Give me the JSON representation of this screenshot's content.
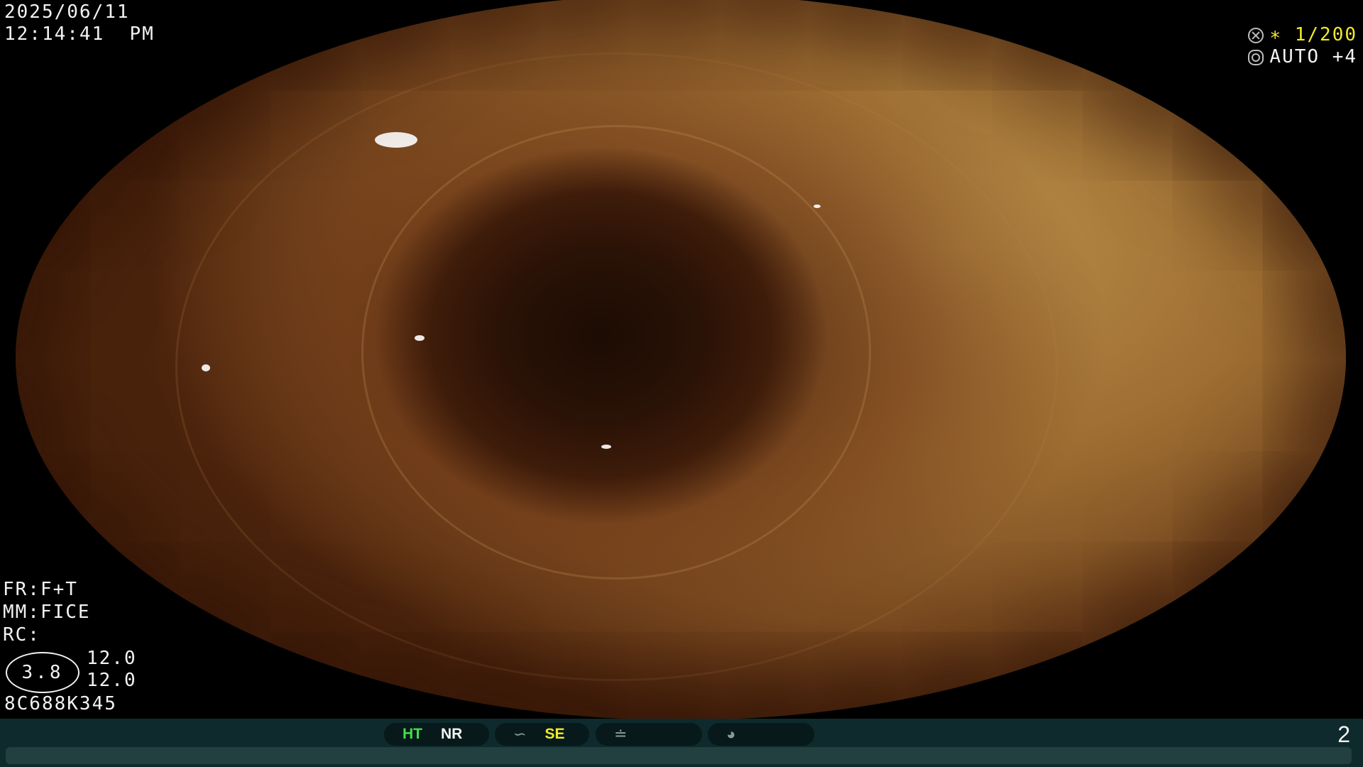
{
  "overlay": {
    "date": "2025/06/11",
    "time": "12:14:41  PM",
    "fr": "FR:F+T",
    "mm": "MM:FICE",
    "rc": "RC:",
    "scope_value": "3.8",
    "value_1": "12.0",
    "value_2": "12.0",
    "serial": "8C688K345"
  },
  "top_right": {
    "shutter": "∗ 1/200",
    "iris": "AUTO +4",
    "shutter_icon": "shutter-icon",
    "iris_icon": "iris-icon",
    "shutter_color": "#f2ea2a"
  },
  "status": {
    "ht": "HT",
    "nr": "NR",
    "se": "SE",
    "se_icon": "wave-icon",
    "slash_icon": "slash-wave-icon",
    "gauge_icon": "gauge-icon",
    "page": "2",
    "ht_color": "#3fe04a",
    "se_color": "#f2ea2a"
  }
}
